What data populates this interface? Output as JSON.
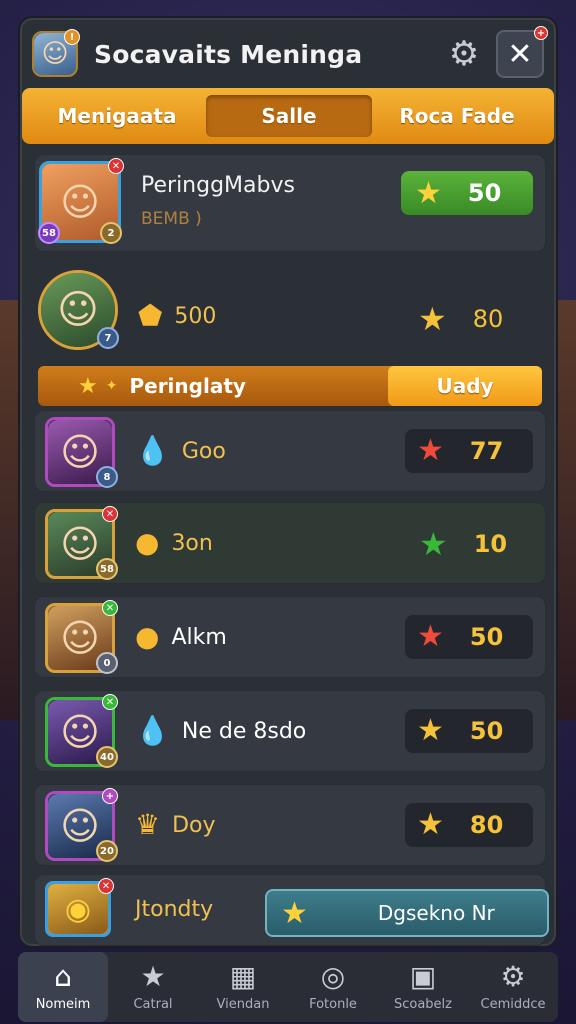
{
  "header": {
    "title": "Socavaits Meninga",
    "avatar_icon": "player-portrait",
    "badge": "✕"
  },
  "tabs": [
    {
      "label": "Menigaata"
    },
    {
      "label": "Salle"
    },
    {
      "label": "Roca Fade"
    }
  ],
  "featured": {
    "name": "PeringgMabvs",
    "sub": "BEMB )",
    "level": "58",
    "rank": "2",
    "score": "50"
  },
  "second": {
    "rank": "7",
    "resource": "500",
    "score": "80"
  },
  "banner": {
    "label": "Peringlaty",
    "button": "Uady"
  },
  "rows": [
    {
      "level": "8",
      "resource": "Goo",
      "score": "77",
      "star_color": "#f04a3a"
    },
    {
      "level": "58",
      "resource": "3on",
      "score": "10",
      "star_color": "#3ab83a"
    },
    {
      "level": "0",
      "resource": "Alkm",
      "score": "50",
      "star_color": "#f04a3a"
    },
    {
      "level": "40",
      "resource": "Ne de 8sdo",
      "score": "50",
      "star_color": "#f6c23a"
    },
    {
      "level": "20",
      "resource": "Doy",
      "score": "80",
      "star_color": "#f6c23a"
    }
  ],
  "bottom": {
    "label": "Jtondty",
    "button": "Dgsekno Nr"
  },
  "nav": [
    {
      "label": "Nomeim",
      "icon": "home-icon"
    },
    {
      "label": "Catral",
      "icon": "star-icon"
    },
    {
      "label": "Viendan",
      "icon": "grid-icon"
    },
    {
      "label": "Fotonle",
      "icon": "target-icon"
    },
    {
      "label": "Scoabelz",
      "icon": "chest-icon"
    },
    {
      "label": "Cemiddce",
      "icon": "gear-icon"
    }
  ]
}
